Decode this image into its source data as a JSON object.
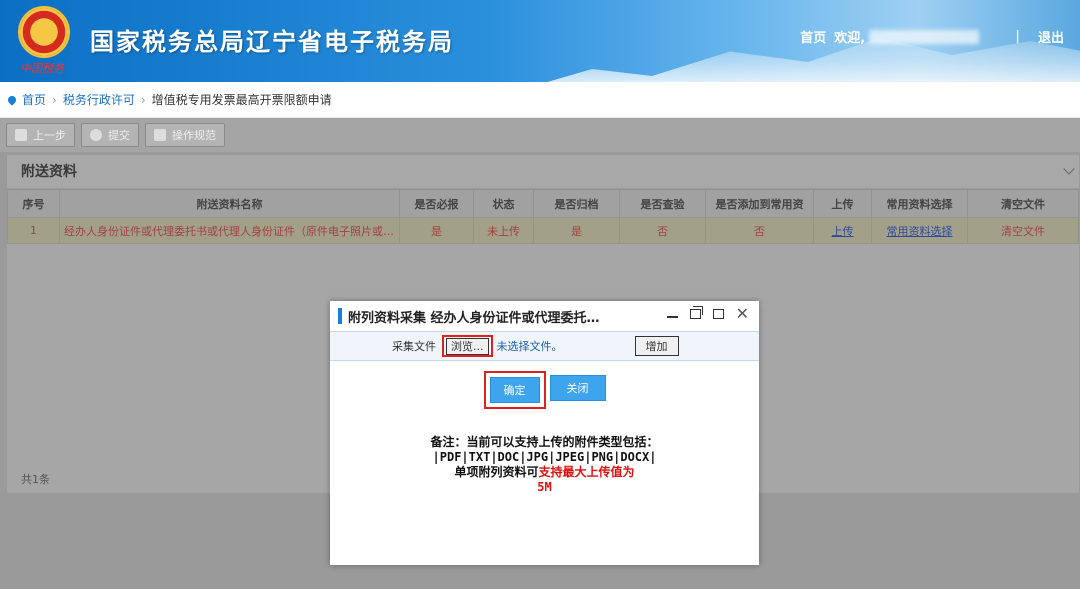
{
  "header": {
    "emblem_caption": "中国税务",
    "site_title": "国家税务总局辽宁省电子税务局",
    "home": "首页",
    "welcome": "欢迎,",
    "separator": "|",
    "logout": "退出"
  },
  "breadcrumb": {
    "items": [
      "首页",
      "税务行政许可",
      "增值税专用发票最高开票限额申请"
    ]
  },
  "toolbar": {
    "prev": "上一步",
    "submit": "提交",
    "guide": "操作规范"
  },
  "panel": {
    "title": "附送资料",
    "columns": [
      "序号",
      "附送资料名称",
      "是否必报",
      "状态",
      "是否归档",
      "是否查验",
      "是否添加到常用资",
      "上传",
      "常用资料选择",
      "清空文件"
    ],
    "rows": [
      {
        "index": "1",
        "name": "经办人身份证件或代理委托书或代理人身份证件（原件电子照片或…",
        "required": "是",
        "status": "未上传",
        "archived": "是",
        "verified": "否",
        "add_common": "否",
        "upload": "上传",
        "choose_common": "常用资料选择",
        "clear": "清空文件"
      }
    ],
    "total": "共1条"
  },
  "modal": {
    "title": "附列资料采集  经办人身份证件或代理委托…",
    "file_label": "采集文件",
    "browse": "浏览...",
    "no_file": "未选择文件。",
    "add": "增加",
    "ok": "确定",
    "close": "关闭",
    "note_line1": "备注：当前可以支持上传的附件类型包括：",
    "note_line2": "|PDF|TXT|DOC|JPG|JPEG|PNG|DOCX|",
    "note_line3a": "单项附列资料可",
    "note_line3b": "支持最大上传值为",
    "note_line4": "5M"
  }
}
